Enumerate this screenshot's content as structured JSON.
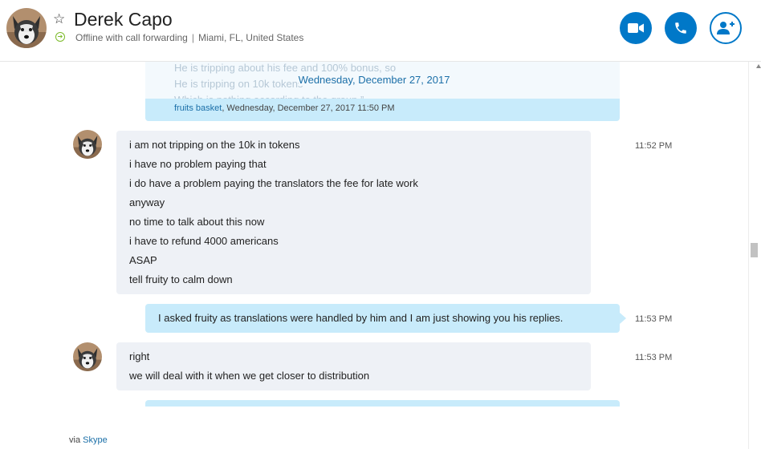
{
  "contact": {
    "name": "Derek Capo",
    "status": "Offline with call forwarding",
    "separator": "|",
    "location": "Miami, FL, United States"
  },
  "actions": {
    "video_call": "video-call",
    "audio_call": "audio-call",
    "add_people": "add-people"
  },
  "quoted_message": {
    "lines": [
      "He is tripping about his fee and 100% bonus, so",
      "He is tripping on 10k tokens",
      "Which is nothing according to the group ”"
    ],
    "sender": "fruits basket",
    "timestamp": ", Wednesday, December 27, 2017 11:50 PM"
  },
  "date_separator": "Wednesday, December 27, 2017",
  "messages": [
    {
      "direction": "incoming",
      "time": "11:52 PM",
      "lines": [
        "i am not tripping on the 10k in tokens",
        "i have no problem paying that",
        "i do have a problem paying the translators the fee for late work",
        "anyway",
        "no time to talk about this now",
        "i have to refund 4000 americans",
        "ASAP",
        "tell fruity to calm down"
      ]
    },
    {
      "direction": "outgoing",
      "time": "11:53 PM",
      "lines": [
        "I asked fruity as translations were handled by him and I am just showing you his replies."
      ]
    },
    {
      "direction": "incoming",
      "time": "11:53 PM",
      "lines": [
        "right",
        "we will deal with it when we get closer to distribution"
      ]
    }
  ],
  "footer": {
    "via": "via",
    "app": "Skype"
  },
  "colors": {
    "accent": "#0078c8",
    "incoming_bubble": "#eef1f6",
    "outgoing_bubble": "#c8ebfb",
    "online_status": "#7cbb2a",
    "link": "#1b6fa8"
  }
}
